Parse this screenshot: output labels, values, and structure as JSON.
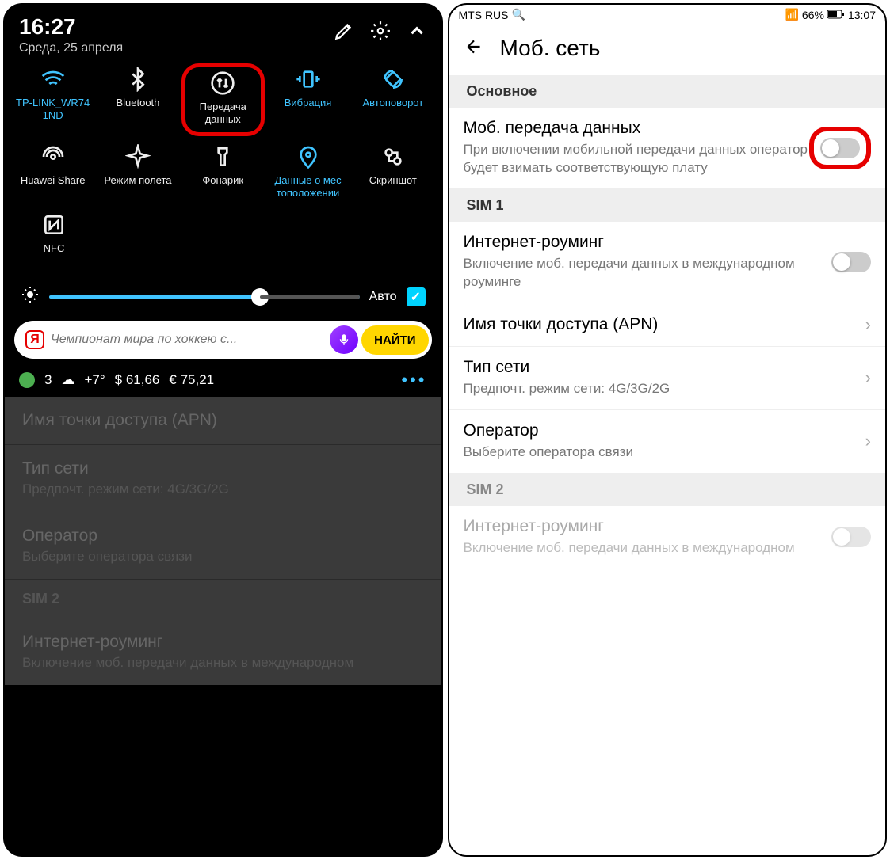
{
  "phone1": {
    "time": "16:27",
    "date": "Среда, 25 апреля",
    "tiles": [
      {
        "label": "TP-LINK_WR74\n1ND",
        "color": "blue"
      },
      {
        "label": "Bluetooth",
        "color": "white"
      },
      {
        "label": "Передача данных",
        "color": "white",
        "highlighted": true
      },
      {
        "label": "Вибрация",
        "color": "blue"
      },
      {
        "label": "Автоповорот",
        "color": "blue"
      },
      {
        "label": "Huawei Share",
        "color": "white"
      },
      {
        "label": "Режим полета",
        "color": "white"
      },
      {
        "label": "Фонарик",
        "color": "white"
      },
      {
        "label": "Данные о мес\nтоположении",
        "color": "blue"
      },
      {
        "label": "Скриншот",
        "color": "white"
      },
      {
        "label": "NFC",
        "color": "white"
      }
    ],
    "brightness_auto": "Авто",
    "search_placeholder": "Чемпионат мира по хоккею с...",
    "find_btn": "НАЙТИ",
    "info": {
      "count": "3",
      "temp": "+7°",
      "usd": "$ 61,66",
      "eur": "€ 75,21"
    },
    "dimmed": {
      "apn_title": "Имя точки доступа (APN)",
      "net_title": "Тип сети",
      "net_sub": "Предпочт. режим сети: 4G/3G/2G",
      "op_title": "Оператор",
      "op_sub": "Выберите оператора связи",
      "sim2": "SIM 2",
      "roam_title": "Интернет-роуминг",
      "roam_sub": "Включение моб. передачи данных в международном"
    }
  },
  "phone2": {
    "carrier": "MTS RUS",
    "battery": "66%",
    "time": "13:07",
    "title": "Моб. сеть",
    "main_section": "Основное",
    "mobile_data": {
      "title": "Моб. передача данных",
      "sub": "При включении мобильной передачи данных оператор будет взимать соответствующую плату"
    },
    "sim1": "SIM 1",
    "roaming1": {
      "title": "Интернет-роуминг",
      "sub": "Включение моб. передачи данных в международном роуминге"
    },
    "apn": "Имя точки доступа (APN)",
    "net_type": {
      "title": "Тип сети",
      "sub": "Предпочт. режим сети: 4G/3G/2G"
    },
    "operator": {
      "title": "Оператор",
      "sub": "Выберите оператора связи"
    },
    "sim2": "SIM 2",
    "roaming2": {
      "title": "Интернет-роуминг",
      "sub": "Включение моб. передачи данных в международном"
    }
  }
}
